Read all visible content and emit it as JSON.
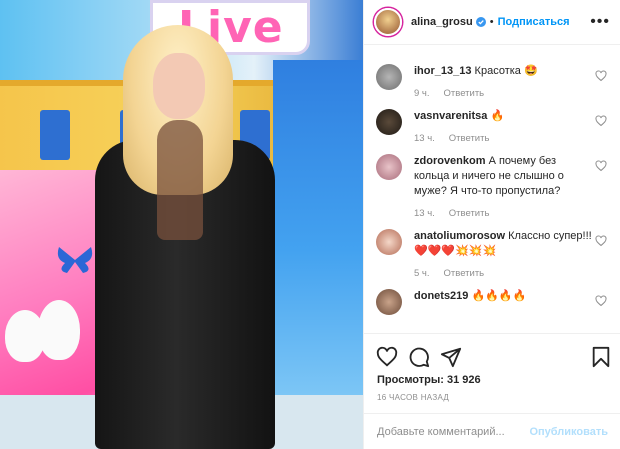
{
  "media": {
    "sign_text": "Live"
  },
  "header": {
    "username": "alina_grosu",
    "follow_label": "Подписаться",
    "separator": "•"
  },
  "comments": [
    {
      "user": "ihor_13_13",
      "text": "Красотка 🤩",
      "time": "9 ч.",
      "reply": "Ответить"
    },
    {
      "user": "vasnvarenitsa",
      "text": "🔥",
      "time": "13 ч.",
      "reply": "Ответить"
    },
    {
      "user": "zdorovenkom",
      "text": "А почему без кольца и ничего не слышно о муже? Я что-то пропустила?",
      "time": "13 ч.",
      "reply": "Ответить"
    },
    {
      "user": "anatoliumorosow",
      "text": "Классно супер!!!❤️❤️❤️💥💥💥",
      "time": "5 ч.",
      "reply": "Ответить"
    },
    {
      "user": "donets219",
      "text": "🔥🔥🔥🔥",
      "time": "",
      "reply": ""
    }
  ],
  "stats": {
    "views": "Просмотры: 31 926",
    "time_ago": "16 ЧАСОВ НАЗАД"
  },
  "add_comment": {
    "placeholder": "Добавьте комментарий...",
    "post_label": "Опубликовать"
  },
  "colors": {
    "accent": "#0095f6",
    "post_disabled": "#b2dffc",
    "meta": "#8e8e8e"
  },
  "icons": [
    "verified-badge-icon",
    "more-options-icon",
    "heart-icon",
    "comment-icon",
    "share-icon",
    "bookmark-icon"
  ]
}
